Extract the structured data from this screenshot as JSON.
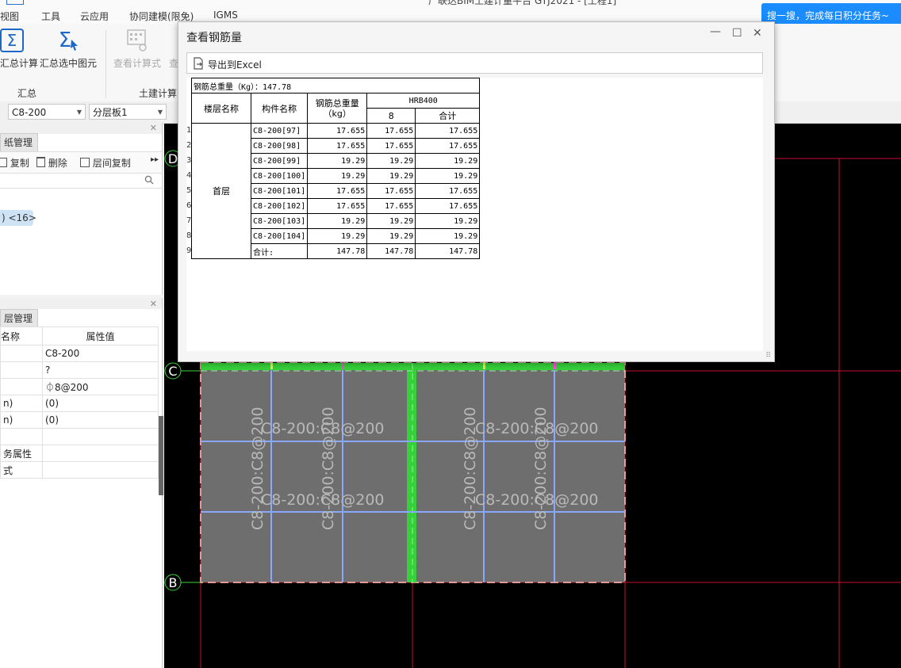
{
  "window_title": "广联达BIM土建计量平台 GTJ2021 - [工程1]",
  "menu": [
    "视图",
    "工具",
    "云应用",
    "协同建模(限免)",
    "IGMS"
  ],
  "promo": "搜一搜，完成每日积分任务~",
  "ribbon": {
    "sum_calc": "汇总计算",
    "sum_selected": "汇总选中图元",
    "group_summary": "汇总",
    "view_formula": "查看计算式",
    "view_more": "查",
    "group_tujian": "土建计算"
  },
  "combos": {
    "c1": "C8-200",
    "c2": "分层板1"
  },
  "drawing_panel": {
    "tab": "纸管理",
    "copy": "复制",
    "delete": "删除",
    "layer_copy": "层间复制",
    "more": "▸▸",
    "tag": ") <16>"
  },
  "layer_panel": {
    "tab": "层管理",
    "header_name": "名称",
    "header_value": "属性值",
    "rows": [
      {
        "name": "",
        "value": "C8-200"
      },
      {
        "name": "",
        "value": "?"
      },
      {
        "name": "",
        "value": "⏀8@200"
      },
      {
        "name": "n)",
        "value": "(0)"
      },
      {
        "name": "n)",
        "value": "(0)"
      },
      {
        "name": "",
        "value": ""
      },
      {
        "name": "务属性",
        "value": ""
      },
      {
        "name": "式",
        "value": ""
      }
    ]
  },
  "canvas": {
    "axis_labels": [
      "D",
      "C",
      "B"
    ],
    "slab_labels": [
      "C8-200:C8@200",
      "C8-200:C8@200",
      "C8-200:C8@200",
      "C8-200:C8@200"
    ],
    "slab_labels_vertical": [
      "C8-200:C8@200",
      "C8-200:C8@200",
      "C8-200:C8@200",
      "C8-200:C8@200"
    ]
  },
  "dialog": {
    "title": "查看钢筋量",
    "export_label": "导出到Excel",
    "total_label": "钢筋总重量（Kg）：147.78",
    "headers": {
      "floor": "楼层名称",
      "component": "构件名称",
      "total_weight": "钢筋总重量（kg）",
      "grade": "HRB400",
      "diameter": "8",
      "subtotal": "合计"
    },
    "floor_name": "首层",
    "row_numbers": [
      "1",
      "2",
      "3",
      "4",
      "5",
      "6",
      "7",
      "8",
      "9"
    ],
    "rows": [
      {
        "name": "C8-200[97]",
        "total": "17.655",
        "d8": "17.655",
        "sum": "17.655"
      },
      {
        "name": "C8-200[98]",
        "total": "17.655",
        "d8": "17.655",
        "sum": "17.655"
      },
      {
        "name": "C8-200[99]",
        "total": "19.29",
        "d8": "19.29",
        "sum": "19.29"
      },
      {
        "name": "C8-200[100]",
        "total": "19.29",
        "d8": "19.29",
        "sum": "19.29"
      },
      {
        "name": "C8-200[101]",
        "total": "17.655",
        "d8": "17.655",
        "sum": "17.655"
      },
      {
        "name": "C8-200[102]",
        "total": "17.655",
        "d8": "17.655",
        "sum": "17.655"
      },
      {
        "name": "C8-200[103]",
        "total": "19.29",
        "d8": "19.29",
        "sum": "19.29"
      },
      {
        "name": "C8-200[104]",
        "total": "19.29",
        "d8": "19.29",
        "sum": "19.29"
      }
    ],
    "total_row": {
      "name": "合计:",
      "total": "147.78",
      "d8": "147.78",
      "sum": "147.78"
    }
  }
}
